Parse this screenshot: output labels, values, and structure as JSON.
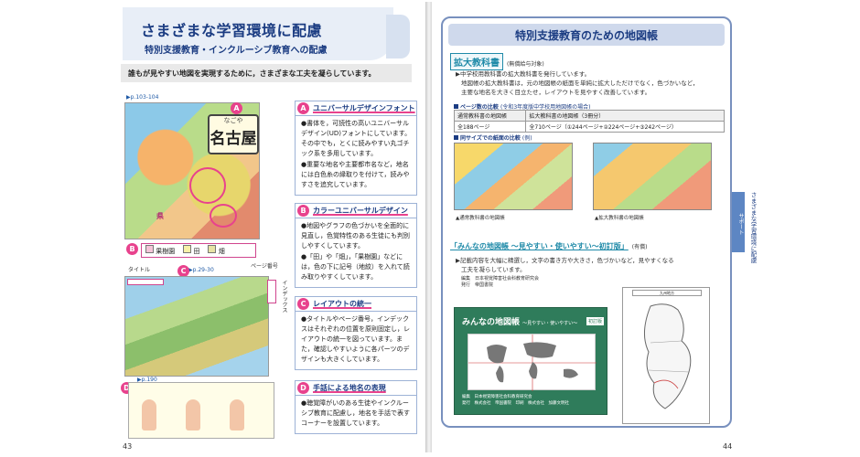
{
  "left": {
    "title": "さまざまな学習環境に配慮",
    "subtitle": "特別支援教育・インクルーシブ教育への配慮",
    "lead": "誰もが見やすい地図を実現するために，さまざまな工夫を凝らしています。",
    "refs": {
      "a": "p.103-104",
      "c": "p.29-30",
      "d": "p.190"
    },
    "map_labels": {
      "title": "タイトル",
      "page_number": "ページ番号",
      "index": "インデックス"
    },
    "city": {
      "furigana": "なごや",
      "name": "名古屋"
    },
    "ken": "県",
    "legend": [
      "果樹園",
      "田",
      "畑"
    ],
    "legend_colors": [
      "#f4c4d8",
      "#f7f1a8",
      "#e7e2a4"
    ],
    "features": [
      {
        "badge": "A",
        "title": "ユニバーサルデザインフォント",
        "lines": [
          "●書体を，可読性の高いユニバーサルデザイン(UD)フォントにしています。その中でも，とくに読みやすい丸ゴチック系を多用しています。",
          "●重要な地名や主要都市名など，地名には白色糸の縁取りを付けて，読みやすさを追究しています。"
        ]
      },
      {
        "badge": "B",
        "title": "カラーユニバーサルデザイン",
        "lines": [
          "●地図やグラフの色づかいを全面的に見直し，色覚特性のある生徒にも判別しやすくしています。",
          "●「田」や「畑」，「果樹園」などには，色の下に記号（地紋）を入れて読み取りやすくしています。"
        ]
      },
      {
        "badge": "C",
        "title": "レイアウトの統一",
        "lines": [
          "●タイトルやページ番号，インデックスはそれぞれの位置を原則固定し，レイアウトの統一を図っています。また，確認しやすいように各パーツのデザインも大きくしています。"
        ]
      },
      {
        "badge": "D",
        "title": "手話による地名の表現",
        "lines": [
          "●聴覚障がいのある生徒やインクルーシブ教育に配慮し，地名を手話で表すコーナーを設置しています。"
        ]
      }
    ],
    "page_number": "43"
  },
  "right": {
    "title": "特別支援教育のための地図帳",
    "sec1": {
      "name": "拡大教科書",
      "note": "(無償給与対象)"
    },
    "sec1_lines": [
      "▶中学校用教科書の拡大教科書を発行しています。",
      "地図帳の拡大教科書は，元の地図帳の紙面を単純に拡大しただけでなく，色づかいなど，",
      "主要な地名を大きく目立たせ，レイアウトを見やすく改善しています。"
    ],
    "page_compare": {
      "label": "ページ数の比較",
      "note": "(令和3年度版中学校用地図帳の場合)"
    },
    "table": [
      [
        "通常教科書の地図帳",
        "拡大教科書の地図帳（3冊分）"
      ],
      [
        "全188ページ",
        "全710ページ（①244ページ+②224ページ+③242ページ）"
      ]
    ],
    "same_size": {
      "label": "同サイズでの紙面の比較",
      "note": "(例)"
    },
    "captions": [
      "▲通常教科書の地図帳",
      "▲拡大教科書の地図帳"
    ],
    "sec2": {
      "name": "「みんなの地図帳 ～見やすい・使いやすい～初訂版」",
      "note": "(有償)"
    },
    "sec2_lines": [
      "▶記載内容を大幅に精選し，文字の書き方や大きさ，色づかいなど，見やすくなる",
      "工夫を凝らしています。"
    ],
    "credits": [
      "編集　日本視覚障害社会科教育研究会",
      "発行　帝国書院"
    ],
    "book": {
      "title": "みんなの地図帳",
      "subtitle": "～見やすい・使いやすい～",
      "tag": "初訂版",
      "pub": [
        "編集　日本視覚障害社会科教育研究会",
        "発行　株式会社　帝国書院　印刷　株式会社　加藤文明社"
      ]
    },
    "kyushu_header": "九州地方",
    "side_tab": "サポート",
    "side_label": "さまざまな学習環境に配慮",
    "page_number": "44"
  }
}
